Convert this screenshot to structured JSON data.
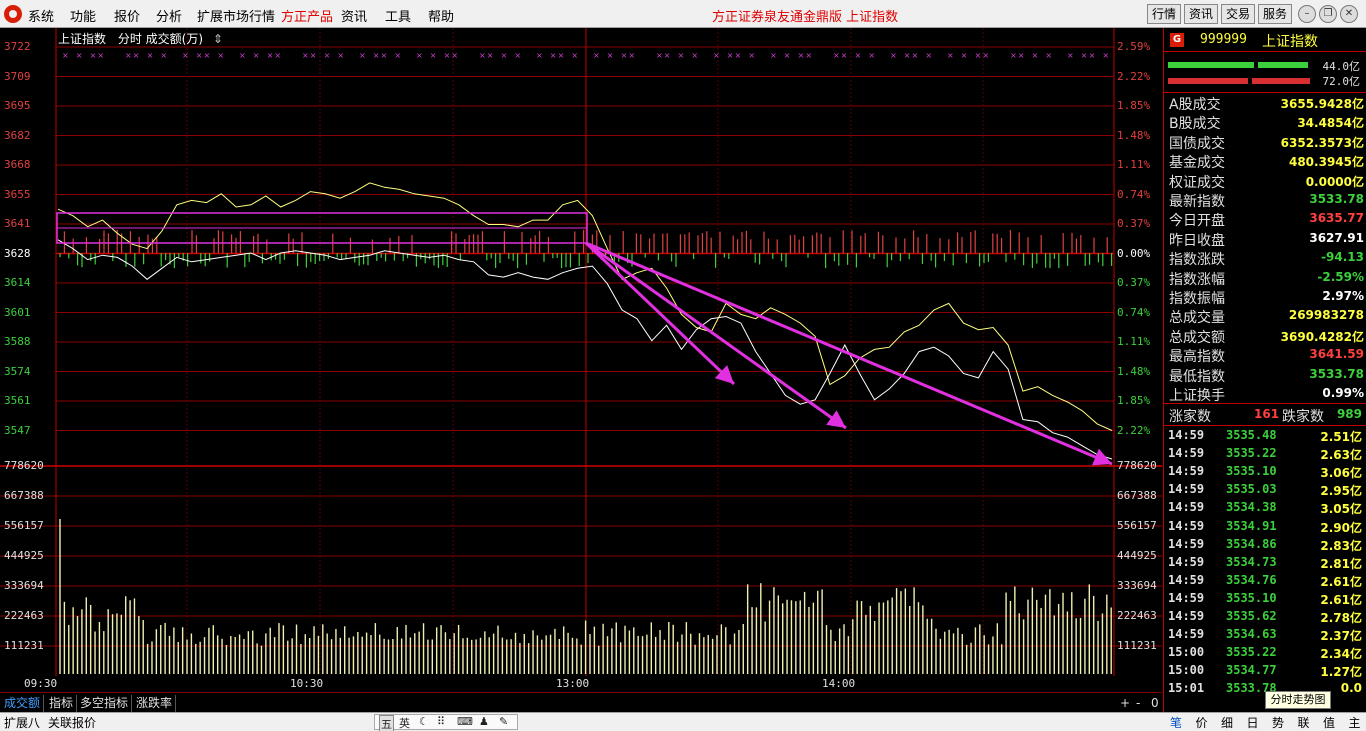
{
  "menu": {
    "items": [
      "系统",
      "功能",
      "报价",
      "分析",
      "扩展市场行情",
      "方正产品",
      "资讯",
      "工具",
      "帮助"
    ],
    "center_title": "方正证券泉友通金鼎版    上证指数",
    "right_buttons": [
      "行情",
      "资讯",
      "交易",
      "服务"
    ]
  },
  "chart": {
    "header_name": "上证指数",
    "header_mode": "分时 成交额(万)",
    "header_sort_icon": "up-down-arrow-icon",
    "price_labels": [
      "3722",
      "3709",
      "3695",
      "3682",
      "3668",
      "3655",
      "3641",
      "3628",
      "3614",
      "3601",
      "3588",
      "3574",
      "3561",
      "3547"
    ],
    "pct_labels": [
      "2.59%",
      "2.22%",
      "1.85%",
      "1.48%",
      "1.11%",
      "0.74%",
      "0.37%",
      "0.00%",
      "0.37%",
      "0.74%",
      "1.11%",
      "1.48%",
      "1.85%",
      "2.22%"
    ],
    "volume_labels": [
      "778620",
      "667388",
      "556157",
      "444925",
      "333694",
      "222463",
      "111231"
    ],
    "time_labels": [
      "09:30",
      "10:30",
      "13:00",
      "14:00"
    ],
    "colors": {
      "up": "#e04040",
      "down": "#3cd03c",
      "index_line": "#ffffff",
      "avg_line": "#ffff80",
      "annotation": "#e030e0",
      "grid": "#8a0000"
    }
  },
  "chart_data": {
    "type": "line",
    "x_range": [
      "09:30",
      "15:00"
    ],
    "ylim": [
      3533.78,
      3722
    ],
    "base": 3627.91,
    "open": 3635.77,
    "close": 3533.78,
    "high": 3641.59,
    "low": 3533.78,
    "series": [
      {
        "values": [
          3634,
          3630,
          3625,
          3627,
          3626,
          3622,
          3616,
          3621,
          3626,
          3624,
          3625,
          3626,
          3627,
          3628,
          3625,
          3628,
          3629,
          3628,
          3627,
          3625,
          3626,
          3627,
          3629,
          3628,
          3627,
          3626,
          3627,
          3625,
          3624,
          3618,
          3617,
          3619,
          3617,
          3616,
          3619,
          3621,
          3622,
          3614,
          3602,
          3598,
          3588,
          3595,
          3584,
          3593,
          3598,
          3599,
          3596,
          3583,
          3573,
          3563,
          3559,
          3561,
          3573,
          3586,
          3573,
          3561,
          3566,
          3573,
          3583,
          3585,
          3581,
          3573,
          3571,
          3583,
          3575,
          3552,
          3551,
          3546,
          3544,
          3540,
          3536,
          3534
        ]
      },
      {
        "values": [
          3648,
          3645,
          3640,
          3643,
          3637,
          3632,
          3630,
          3638,
          3650,
          3652,
          3651,
          3655,
          3649,
          3650,
          3654,
          3649,
          3652,
          3656,
          3655,
          3653,
          3656,
          3660,
          3658,
          3657,
          3655,
          3654,
          3653,
          3650,
          3645,
          3641,
          3641,
          3640,
          3643,
          3643,
          3650,
          3652,
          3645,
          3630,
          3616,
          3619,
          3621,
          3612,
          3600,
          3594,
          3592,
          3605,
          3600,
          3598,
          3603,
          3600,
          3596,
          3590,
          3568,
          3572,
          3580,
          3584,
          3585,
          3592,
          3595,
          3602,
          3605,
          3596,
          3593,
          3594,
          3586,
          3565,
          3567,
          3563,
          3560,
          3556,
          3550,
          3547
        ]
      }
    ],
    "volume_axis_max": 778620
  },
  "panel": {
    "badge": "G",
    "code": "999999",
    "name": "上证指数",
    "bar_values": [
      "44.0亿",
      "72.0亿"
    ],
    "stats": [
      {
        "label": "A股成交",
        "value": "3655.9428亿",
        "color": "#ffff40"
      },
      {
        "label": "B股成交",
        "value": "34.4854亿",
        "color": "#ffff40"
      },
      {
        "label": "国债成交",
        "value": "6352.3573亿",
        "color": "#ffff40"
      },
      {
        "label": "基金成交",
        "value": "480.3945亿",
        "color": "#ffff40"
      },
      {
        "label": "权证成交",
        "value": "0.0000亿",
        "color": "#ffff40"
      },
      {
        "label": "最新指数",
        "value": "3533.78",
        "color": "#3cd03c"
      },
      {
        "label": "今日开盘",
        "value": "3635.77",
        "color": "#ff4040"
      },
      {
        "label": "昨日收盘",
        "value": "3627.91",
        "color": "#ffffff"
      },
      {
        "label": "指数涨跌",
        "value": "-94.13",
        "color": "#3cd03c"
      },
      {
        "label": "指数涨幅",
        "value": "-2.59%",
        "color": "#3cd03c"
      },
      {
        "label": "指数振幅",
        "value": "2.97%",
        "color": "#ffffff"
      },
      {
        "label": "总成交量",
        "value": "269983278",
        "color": "#ffff40"
      },
      {
        "label": "总成交额",
        "value": "3690.4282亿",
        "color": "#ffff40"
      },
      {
        "label": "最高指数",
        "value": "3641.59",
        "color": "#ff4040"
      },
      {
        "label": "最低指数",
        "value": "3533.78",
        "color": "#3cd03c"
      },
      {
        "label": "上证换手",
        "value": "0.99%",
        "color": "#ffffff"
      }
    ],
    "up_label": "涨家数",
    "up_count": "161",
    "down_label": "跌家数",
    "down_count": "989",
    "ticks": [
      {
        "time": "14:59",
        "price": "3535.48",
        "vol": "2.51亿"
      },
      {
        "time": "14:59",
        "price": "3535.22",
        "vol": "2.63亿"
      },
      {
        "time": "14:59",
        "price": "3535.10",
        "vol": "3.06亿"
      },
      {
        "time": "14:59",
        "price": "3535.03",
        "vol": "2.95亿"
      },
      {
        "time": "14:59",
        "price": "3534.38",
        "vol": "3.05亿"
      },
      {
        "time": "14:59",
        "price": "3534.91",
        "vol": "2.90亿"
      },
      {
        "time": "14:59",
        "price": "3534.86",
        "vol": "2.83亿"
      },
      {
        "time": "14:59",
        "price": "3534.73",
        "vol": "2.81亿"
      },
      {
        "time": "14:59",
        "price": "3534.76",
        "vol": "2.61亿"
      },
      {
        "time": "14:59",
        "price": "3535.10",
        "vol": "2.61亿"
      },
      {
        "time": "14:59",
        "price": "3535.62",
        "vol": "2.78亿"
      },
      {
        "time": "14:59",
        "price": "3534.63",
        "vol": "2.37亿"
      },
      {
        "time": "15:00",
        "price": "3535.22",
        "vol": "2.34亿"
      },
      {
        "time": "15:00",
        "price": "3534.77",
        "vol": "1.27亿"
      },
      {
        "time": "15:01",
        "price": "3533.78",
        "vol": "0.0"
      }
    ],
    "tooltip": "分时走势图",
    "tabs": [
      "笔",
      "价",
      "细",
      "日",
      "势",
      "联",
      "值",
      "主"
    ]
  },
  "bottom": {
    "tabs": [
      "成交额",
      "指标",
      "多空指标",
      "涨跌率"
    ],
    "nav": [
      "+",
      "-",
      "0"
    ],
    "status_left": [
      "扩展八",
      "关联报价"
    ],
    "ime_glyphs": [
      "五",
      "英",
      "☾",
      "⠿",
      "⌨",
      "♟",
      "✎"
    ]
  }
}
